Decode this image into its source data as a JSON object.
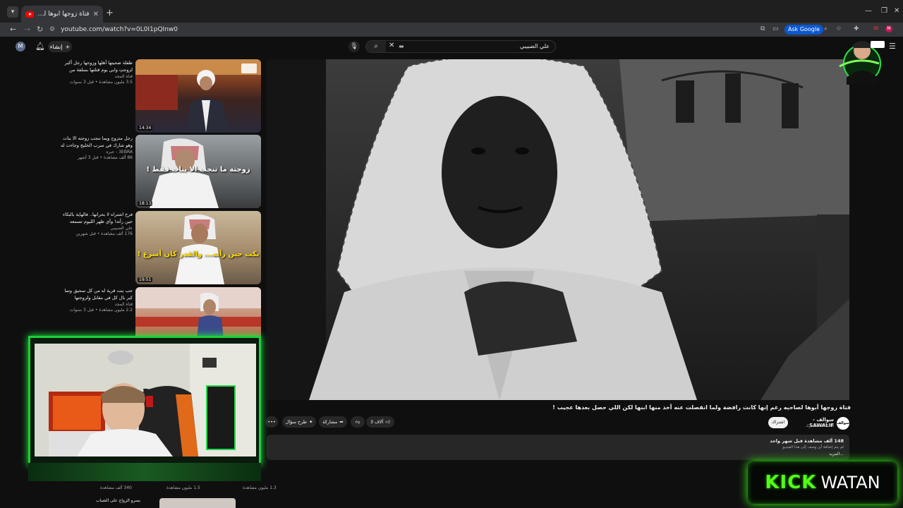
{
  "browser": {
    "tab_title": "فتاة زوجها أبوها لصاحبه رغم ...",
    "url": "youtube.com/watch?v=0L0I1pQInw0",
    "ask_google": "Ask Google"
  },
  "header": {
    "avatar_letter": "M",
    "create_label": "إنشاء",
    "search_value": "علي الضبيبي"
  },
  "recommendations": [
    {
      "title": "طفلة ضحيتها أهلها وزوجها رجل أكبر لزوجتِ وابي يوم قتلتها بسلفة من أمها وما الذي ساق إ...",
      "channel": "قناة المجد",
      "stats": "3.5 مليون مشاهدة • قبل 3 سنوات",
      "duration": "14:34",
      "thumb_text": ""
    },
    {
      "title": "رجل متزوج ويما تنجب زوجته الا بنات وهو شارك في سرب الخليج وجاءت له موقف عبر كل مباحث",
      "channel": "3EBRA - عبره",
      "stats": "86 ألف مشاهدة • قبل 3 أشهر",
      "duration": "18:13",
      "thumb_text": "زوجتة ما تنجب الا بنات فقط !"
    },
    {
      "title": "فرح اشتراه لا بحرانها.. فالهاية بالبكاء حين رأته! وأي ظهر الليوم تسمعه القدر بما لم يكن بالحسبان ! |",
      "channel": "علي الضبيبي",
      "stats": "176 ألف مشاهدة • قبل شهرين",
      "duration": "19:51",
      "thumb_text": "بكت حين رأته... والقدر كان أسرع !"
    },
    {
      "title": "حب بنت قرية له من كل سحيق وتما كبر بال كل في مقابل ولزوجتها والنهاية تعين | عبدالرحمن ...",
      "channel": "قناة المجد",
      "stats": "2.2 مليون مشاهدة • قبل 3 سنوات",
      "duration": "",
      "thumb_text": ""
    }
  ],
  "below_cam": {
    "stat_1": "1.3 مليون مشاهدة",
    "stat_2": "1.5 مليون مشاهدة",
    "stat_3": "340 ألف مشاهدة",
    "next_title": "يسرو الزواج على الشباب"
  },
  "video": {
    "title": "فتاة زوجها أبوها لصاحبه رغم إنها كانت رافضة ولما انفصلت عنه أخذ منها ابنها لكن اللي حصل بعدها عجيب !",
    "channel_name": "سوالف - SAWALIF",
    "channel_logo_text": "سوالف",
    "subscribers": "186 ألف مشترك",
    "join_label": "اشتراك",
    "likes": "3 آلاف",
    "share_label": "مشاركة",
    "ask_label": "طرح سؤال",
    "more_label": "•••",
    "views_date": "148 ألف مشاهدة قبل شهر واحد",
    "description": "لم يتم إضافة أي وصف إلى هذا الفيديو",
    "more_text": "...المزيد"
  },
  "overlay": {
    "kick_word": "KICK",
    "watan_word": "WATAN"
  },
  "colors": {
    "kick_green": "#53fc18",
    "cam_border": "#1ecf3a",
    "ask_google_blue": "#0b57d0"
  }
}
